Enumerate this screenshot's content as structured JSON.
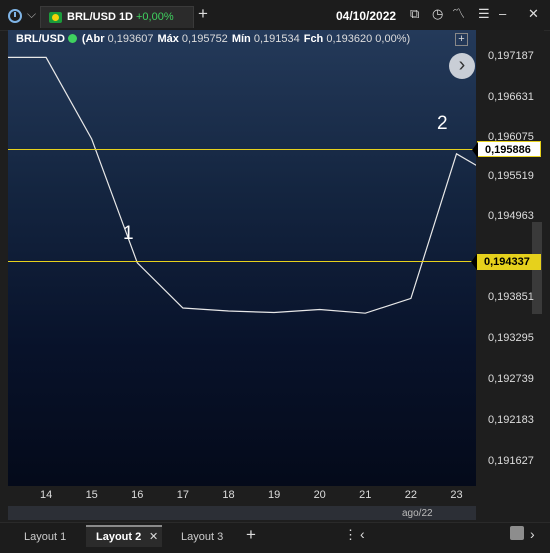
{
  "tab": {
    "title": "BRL/USD 1D",
    "change": "+0,00%"
  },
  "topbar": {
    "date": "04/10/2022",
    "icons": [
      "clock-icon",
      "layout-copy-icon",
      "time-icon",
      "indicators-icon",
      "menu-icon",
      "minimize-icon",
      "maximize-icon",
      "close-icon"
    ],
    "glyphs": {
      "copy": "⧉",
      "time": "◷",
      "indicators": "〽",
      "menu": "☰",
      "minimize": "–",
      "maximize": "☐",
      "close": "✕",
      "clock_caret": "⌵",
      "add": "+"
    }
  },
  "info": {
    "symbol": "BRL/USD",
    "open_label": "(Abr",
    "open_value": "0,193607",
    "high_label": "Máx",
    "high_value": "0,195752",
    "low_label": "Mín",
    "low_value": "0,191534",
    "close_label": "Fch",
    "close_value": "0,193620 0,00%)"
  },
  "price_ticks": [
    "0,197187",
    "0,196631",
    "0,196075",
    "0,195519",
    "0,194963",
    "0,193851",
    "0,193295",
    "0,192739",
    "0,192183",
    "0,191627"
  ],
  "hlines": [
    {
      "price": "0,195886",
      "color": "#e6d11c",
      "label_bg": "#ffffff",
      "label_color": "#000000",
      "label_border": "#e6d11c"
    },
    {
      "price": "0,194337",
      "color": "#e6d11c",
      "label_bg": "#e6d11c",
      "label_color": "#000000",
      "label_border": "#e6d11c"
    }
  ],
  "annotations": [
    "1",
    "2"
  ],
  "chart_data": {
    "type": "line",
    "x": [
      "13",
      "14",
      "15",
      "16",
      "17",
      "18",
      "19",
      "20",
      "21",
      "22",
      "23",
      "24"
    ],
    "series": [
      {
        "values": [
          0.19719,
          0.19719,
          0.19609,
          0.19442,
          0.19381,
          0.19377,
          0.19375,
          0.19379,
          0.19374,
          0.19394,
          0.19589,
          0.19553
        ]
      }
    ],
    "x_ticks": [
      "14",
      "15",
      "16",
      "17",
      "18",
      "19",
      "20",
      "21",
      "22",
      "23"
    ],
    "x_month_label": "ago/22",
    "ylim": [
      0.19141,
      0.19756
    ],
    "line_color": "#e8e8e8"
  },
  "layouts": {
    "tab1": "Layout 1",
    "tab2": "Layout 2",
    "tab3": "Layout 3",
    "close_glyph": "✕",
    "add_glyph": "+",
    "more_glyph": "⋮",
    "left_glyph": "‹",
    "right_glyph": "›"
  },
  "nav": {
    "arrow_glyph": "›",
    "plus_glyph": "+"
  }
}
